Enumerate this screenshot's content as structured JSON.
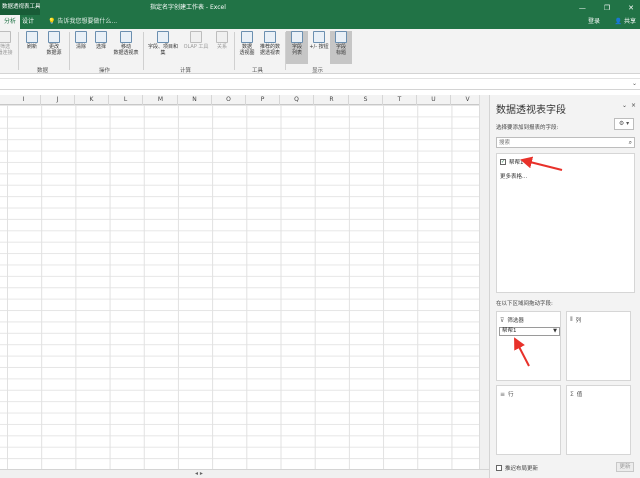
{
  "titlebar": {
    "context_tab": "数据透视表工具",
    "title": "指定名字创建工作表 - Excel",
    "minimize": "—",
    "restore": "❐",
    "close": "✕"
  },
  "tabs": {
    "analyze": "分析",
    "design": "设计",
    "tell_me": "告诉我您想要做什么...",
    "login": "登录",
    "share": "共享"
  },
  "ribbon": {
    "btn_clear_filter": "筛选\n器连接",
    "btn_refresh": "刷新",
    "btn_change_source": "更改\n数据源",
    "btn_clear": "清除",
    "btn_select": "选择",
    "btn_move": "移动\n数据透视表",
    "btn_fields_items": "字段、项目和\n集",
    "btn_olap": "OLAP 工具",
    "btn_relationships": "关系",
    "btn_pivotchart": "数据\n透视图",
    "btn_recommended": "推荐的数\n据透视表",
    "btn_field_list": "字段\n列表",
    "btn_buttons": "+/- 按钮",
    "btn_field_headers": "字段\n标题",
    "grp_data": "数据",
    "grp_actions": "操作",
    "grp_calc": "计算",
    "grp_tools": "工具",
    "grp_show": "显示"
  },
  "columns": [
    "I",
    "J",
    "K",
    "L",
    "M",
    "N",
    "O",
    "P",
    "Q",
    "R",
    "S",
    "T",
    "U",
    "V"
  ],
  "pane": {
    "title": "数据透视表字段",
    "close": "×",
    "choose_fields": "选择要添加到报表的字段:",
    "search_placeholder": "搜索",
    "field_name": "帮帮1",
    "field_checked": "✓",
    "more_tables": "更多表格...",
    "drag_label": "在以下区域间拖动字段:",
    "area_filter": "筛选器",
    "area_columns": "列",
    "area_rows": "行",
    "area_values": "值",
    "filter_chip": "帮帮1",
    "defer_update": "推迟布局更新",
    "update_button": "更新"
  },
  "annotation_color": "#e8312a"
}
